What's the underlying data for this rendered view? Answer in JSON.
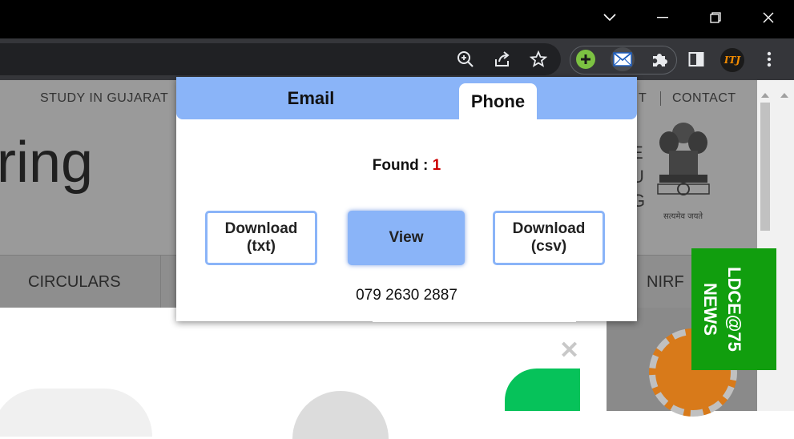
{
  "browser": {
    "window_controls": [
      "chevron-down-icon",
      "minimize-icon",
      "restore-icon",
      "close-icon"
    ],
    "toolbar_icons": [
      "zoom-icon",
      "share-icon",
      "bookmark-star-icon"
    ],
    "extensions": [
      "plus-extension-icon",
      "email-extractor-icon",
      "puzzle-icon"
    ],
    "avatar_text": "ITJ"
  },
  "site": {
    "top_nav": [
      "STUDY IN GUJARAT",
      "T",
      "CONTACT"
    ],
    "heading": "ring",
    "emblem_side_text": [
      "E",
      "U",
      "G"
    ],
    "emblem_caption": "सत्यमेव जयते",
    "nav": [
      "CIRCULARS",
      "NIRF"
    ],
    "news_label": "LDCE@75\nNEWS"
  },
  "popup": {
    "tabs": [
      {
        "label": "Email",
        "active": false
      },
      {
        "label": "Phone",
        "active": true
      }
    ],
    "found_label": "Found :",
    "found_count": "1",
    "buttons": {
      "download_txt": "Download\n(txt)",
      "view": "View",
      "download_csv": "Download\n(csv)"
    },
    "results": [
      "079 2630 2887"
    ]
  },
  "colors": {
    "accent": "#8ab4f8",
    "count_color": "#cc0000",
    "news_green": "#119e0e"
  }
}
